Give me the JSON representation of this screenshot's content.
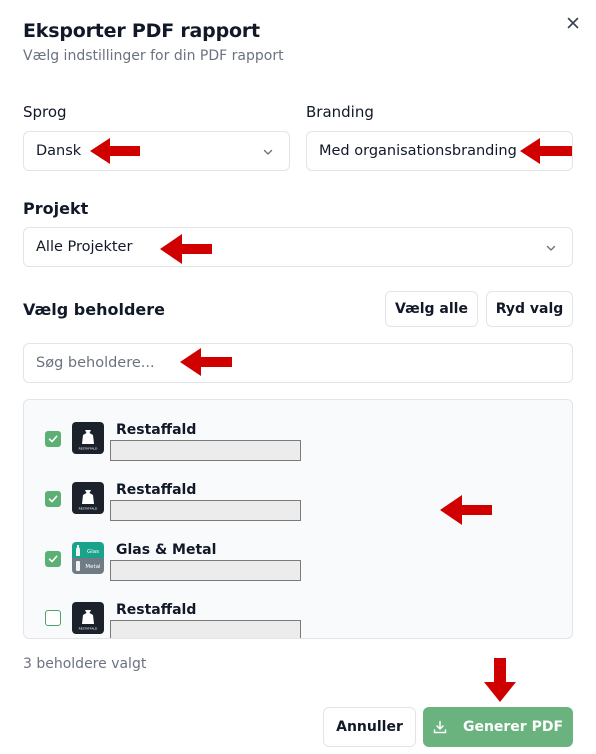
{
  "dialog": {
    "title": "Eksporter PDF rapport",
    "subtitle": "Vælg indstillinger for din PDF rapport",
    "close_icon": "close-icon"
  },
  "language": {
    "label": "Sprog",
    "value": "Dansk"
  },
  "branding": {
    "label": "Branding",
    "value": "Med organisationsbranding"
  },
  "project": {
    "label": "Projekt",
    "value": "Alle Projekter"
  },
  "containers": {
    "label": "Vælg beholdere",
    "select_all_label": "Vælg alle",
    "clear_label": "Ryd valg",
    "search_placeholder": "Søg beholdere...",
    "items": [
      {
        "name": "Restaffald",
        "icon_text": "RESTAFFALD",
        "checked": true
      },
      {
        "name": "Restaffald",
        "icon_text": "RESTAFFALD",
        "checked": true
      },
      {
        "name": "Glas & Metal",
        "icon_text_top": "Glas",
        "icon_text_bottom": "Metal",
        "checked": true
      },
      {
        "name": "Restaffald",
        "icon_text": "RESTAFFALD",
        "checked": false
      }
    ],
    "selected_count_text": "3 beholdere valgt"
  },
  "footer": {
    "cancel_label": "Annuller",
    "generate_label": "Generer PDF"
  },
  "colors": {
    "primary_green": "#6bb37e",
    "checkbox_green": "#5cb074",
    "annotation_red": "#d00000"
  }
}
